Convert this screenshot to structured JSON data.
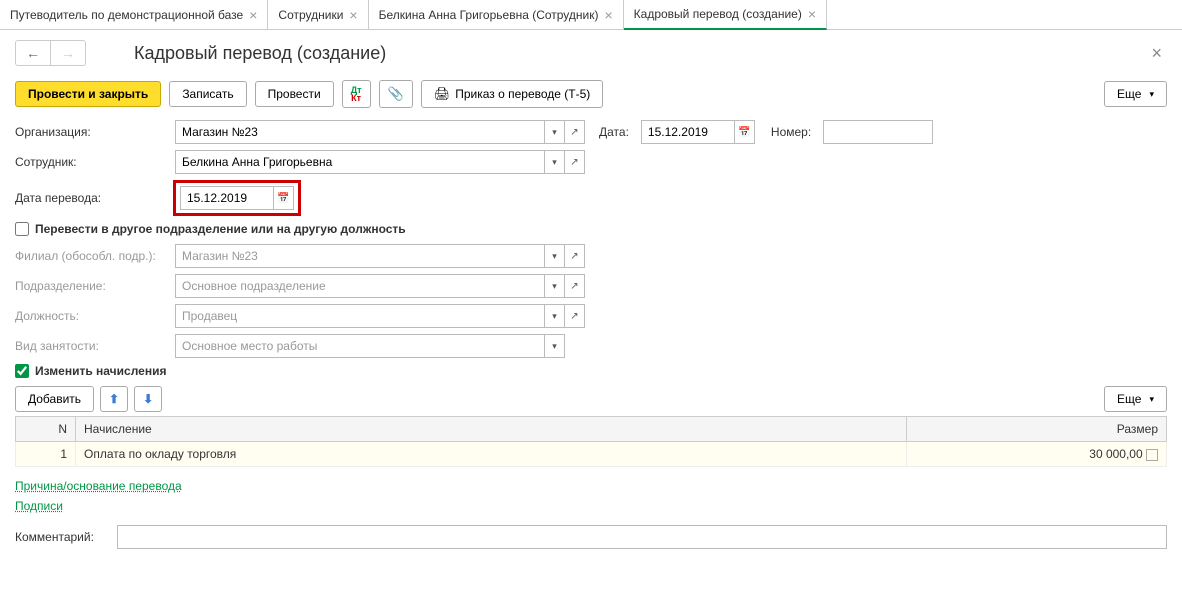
{
  "tabs": [
    {
      "label": "Путеводитель по демонстрационной базе"
    },
    {
      "label": "Сотрудники"
    },
    {
      "label": "Белкина Анна Григорьевна (Сотрудник)"
    },
    {
      "label": "Кадровый перевод (создание)"
    }
  ],
  "page_title": "Кадровый перевод (создание)",
  "toolbar": {
    "post_close": "Провести и закрыть",
    "write": "Записать",
    "post": "Провести",
    "order_t5": "Приказ о переводе (Т-5)",
    "more": "Еще"
  },
  "fields": {
    "org_label": "Организация:",
    "org_value": "Магазин №23",
    "date_label": "Дата:",
    "date_value": "15.12.2019",
    "number_label": "Номер:",
    "number_value": "",
    "employee_label": "Сотрудник:",
    "employee_value": "Белкина Анна Григорьевна",
    "transfer_date_label": "Дата перевода:",
    "transfer_date_value": "15.12.2019",
    "chk_transfer_label": "Перевести в другое подразделение или на другую должность",
    "branch_label": "Филиал (обособл. подр.):",
    "branch_value": "Магазин №23",
    "division_label": "Подразделение:",
    "division_value": "Основное подразделение",
    "position_label": "Должность:",
    "position_value": "Продавец",
    "employment_label": "Вид занятости:",
    "employment_value": "Основное место работы",
    "chk_change_label": "Изменить начисления"
  },
  "table": {
    "add_btn": "Добавить",
    "more_btn": "Еще",
    "headers": {
      "n": "N",
      "accrual": "Начисление",
      "size": "Размер"
    },
    "rows": [
      {
        "n": "1",
        "accrual": "Оплата по окладу торговля",
        "size": "30 000,00"
      }
    ]
  },
  "links": {
    "reason": "Причина/основание перевода",
    "signatures": "Подписи"
  },
  "comment_label": "Комментарий:",
  "comment_value": ""
}
